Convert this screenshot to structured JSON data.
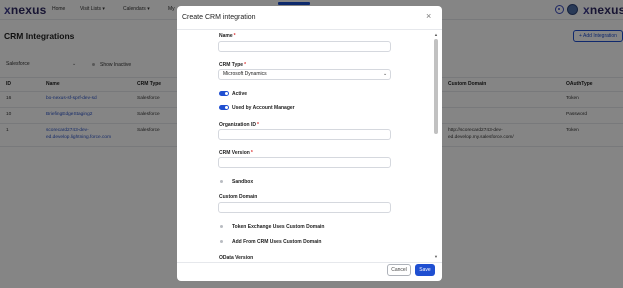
{
  "nav": {
    "logo_mark": "x",
    "logo_text": "nexus",
    "items": [
      {
        "label": "Home"
      },
      {
        "label": "Visit Lists",
        "caret": "▾"
      },
      {
        "label": "Calendars",
        "caret": "▾"
      },
      {
        "label": "My"
      }
    ],
    "icons": [
      "gear-icon",
      "user-avatar"
    ]
  },
  "page": {
    "title": "CRM Integrations",
    "add_button": "+ Add Integration",
    "filter_value": "Salesforce",
    "filter_caret": "⌄",
    "show_inactive": "Show Inactive"
  },
  "table": {
    "headers": [
      "ID",
      "Name",
      "CRM Type",
      "Custom Domain",
      "OAuthType"
    ],
    "rows": [
      {
        "id": "16",
        "name": "bo-nexus-sf-sprf-dev-sd",
        "crm_type": "Salesforce",
        "custom_domain": "",
        "oauth": "Token"
      },
      {
        "id": "10",
        "name": "BriefingEdgeStaging2",
        "crm_type": "Salesforce",
        "custom_domain": "",
        "oauth": "Password"
      },
      {
        "id": "1",
        "name": "scorecard2743-dev-ed.develop.lightning.force.com",
        "crm_type": "Salesforce",
        "custom_domain": "http://scorecard2743-dev-ed.develop.my.salesforce.com/",
        "oauth": "Token"
      }
    ]
  },
  "modal": {
    "title": "Create CRM integration",
    "close": "×",
    "fields": {
      "name_label": "Name",
      "crm_type_label": "CRM Type",
      "crm_type_value": "Microsoft Dynamics",
      "active_label": "Active",
      "used_by_am_label": "Used by Account Manager",
      "org_id_label": "Organization ID",
      "crm_version_label": "CRM Version",
      "sandbox_label": "Sandbox",
      "custom_domain_label": "Custom Domain",
      "token_exchange_label": "Token Exchange Uses Custom Domain",
      "add_from_crm_label": "Add From CRM Uses Custom Domain",
      "odata_version_label": "OData Version"
    },
    "required_mark": "*",
    "select_caret": "⌄",
    "scroll_up": "▲",
    "scroll_down": "▼",
    "cancel": "Cancel",
    "save": "Save"
  },
  "colors": {
    "accent": "#1f4fd1",
    "link": "#2851c8",
    "required": "#dd3333",
    "overlay": "rgba(0,0,0,0.48)"
  }
}
